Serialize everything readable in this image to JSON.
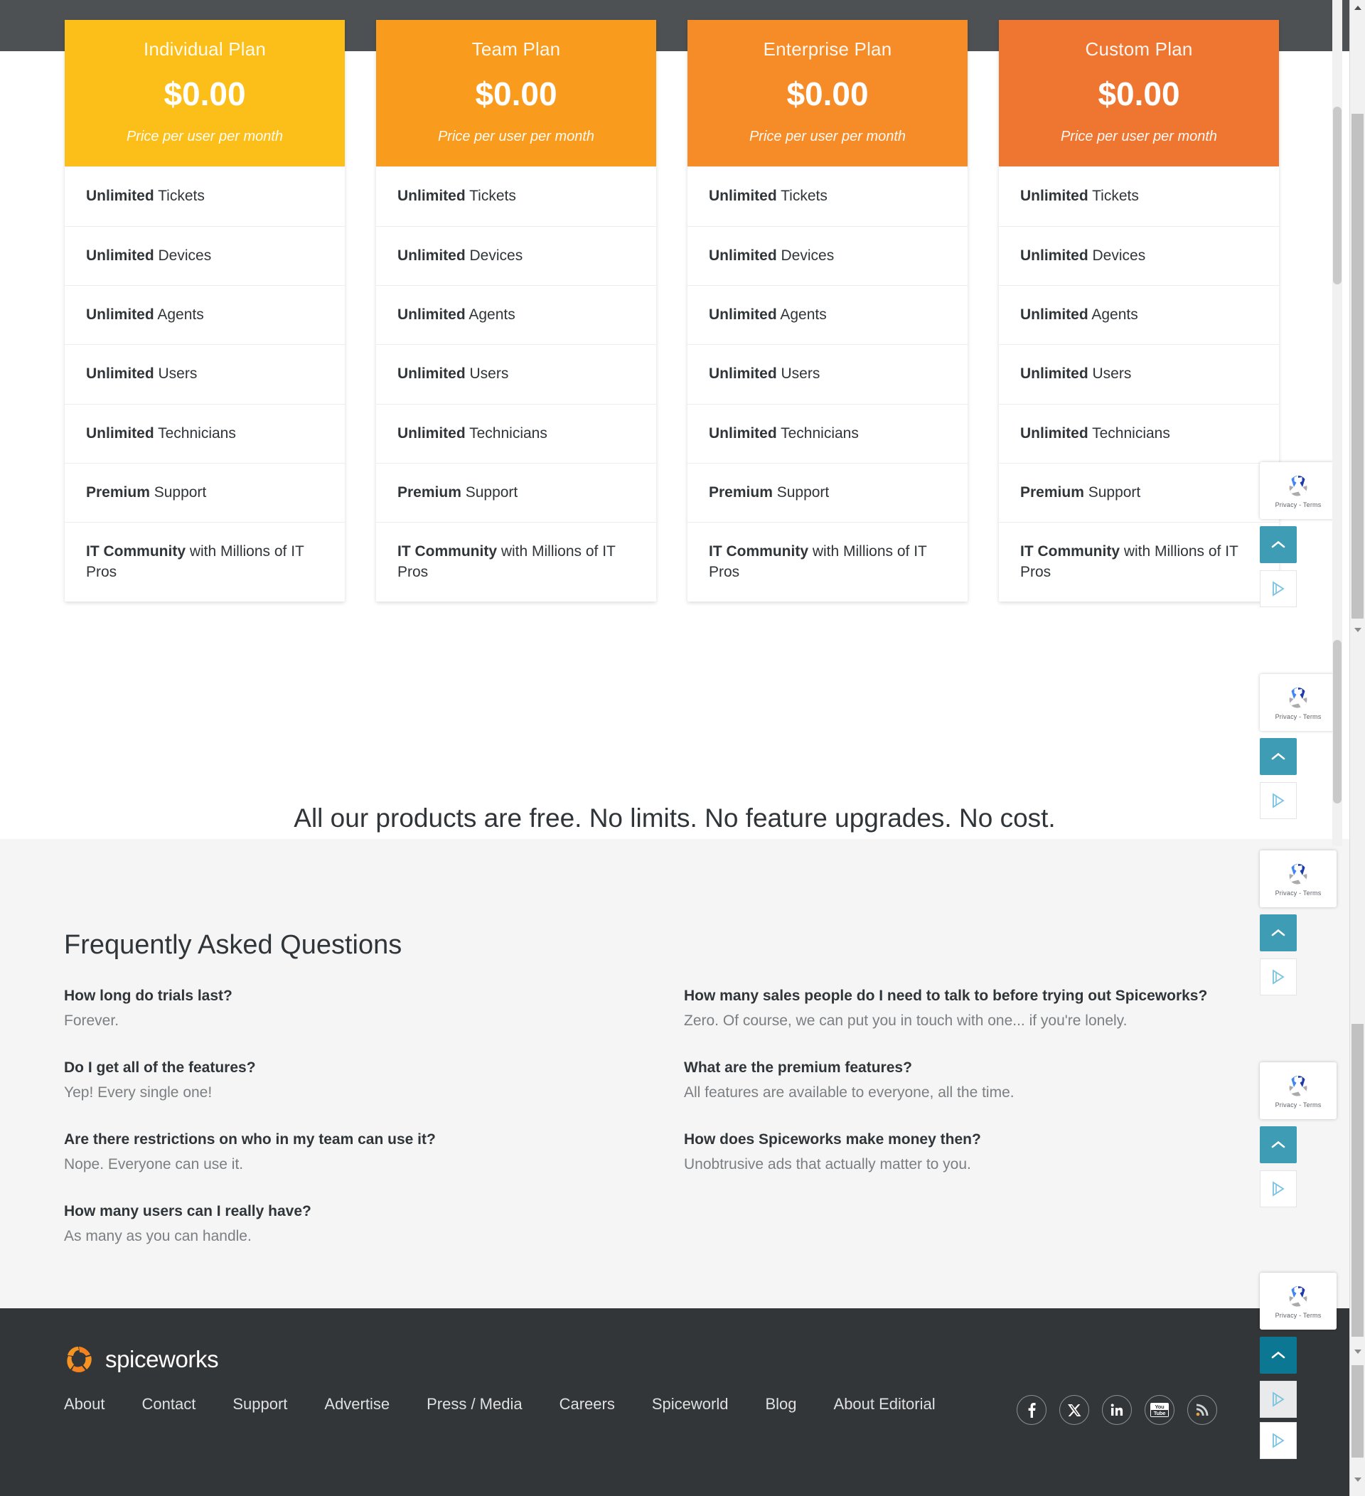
{
  "plans": [
    {
      "name": "Individual Plan",
      "price": "$0.00",
      "note": "Price per user per month",
      "color": "#fcbe18",
      "features": [
        {
          "bold": "Unlimited",
          "rest": " Tickets"
        },
        {
          "bold": "Unlimited",
          "rest": " Devices"
        },
        {
          "bold": "Unlimited",
          "rest": " Agents"
        },
        {
          "bold": "Unlimited",
          "rest": " Users"
        },
        {
          "bold": "Unlimited",
          "rest": " Technicians"
        },
        {
          "bold": "Premium",
          "rest": " Support"
        },
        {
          "bold": "IT Community",
          "rest": " with Millions of IT Pros"
        }
      ]
    },
    {
      "name": "Team Plan",
      "price": "$0.00",
      "note": "Price per user per month",
      "color": "#f99b1c",
      "features": [
        {
          "bold": "Unlimited",
          "rest": " Tickets"
        },
        {
          "bold": "Unlimited",
          "rest": " Devices"
        },
        {
          "bold": "Unlimited",
          "rest": " Agents"
        },
        {
          "bold": "Unlimited",
          "rest": " Users"
        },
        {
          "bold": "Unlimited",
          "rest": " Technicians"
        },
        {
          "bold": "Premium",
          "rest": " Support"
        },
        {
          "bold": "IT Community",
          "rest": " with Millions of IT Pros"
        }
      ]
    },
    {
      "name": "Enterprise Plan",
      "price": "$0.00",
      "note": "Price per user per month",
      "color": "#f68c27",
      "features": [
        {
          "bold": "Unlimited",
          "rest": " Tickets"
        },
        {
          "bold": "Unlimited",
          "rest": " Devices"
        },
        {
          "bold": "Unlimited",
          "rest": " Agents"
        },
        {
          "bold": "Unlimited",
          "rest": " Users"
        },
        {
          "bold": "Unlimited",
          "rest": " Technicians"
        },
        {
          "bold": "Premium",
          "rest": " Support"
        },
        {
          "bold": "IT Community",
          "rest": " with Millions of IT Pros"
        }
      ]
    },
    {
      "name": "Custom Plan",
      "price": "$0.00",
      "note": "Price per user per month",
      "color": "#ef7631",
      "features": [
        {
          "bold": "Unlimited",
          "rest": " Tickets"
        },
        {
          "bold": "Unlimited",
          "rest": " Devices"
        },
        {
          "bold": "Unlimited",
          "rest": " Agents"
        },
        {
          "bold": "Unlimited",
          "rest": " Users"
        },
        {
          "bold": "Unlimited",
          "rest": " Technicians"
        },
        {
          "bold": "Premium",
          "rest": " Support"
        },
        {
          "bold": "IT Community",
          "rest": " with Millions of IT Pros"
        }
      ]
    }
  ],
  "tagline": "All our products are free. No limits. No feature upgrades. No cost.",
  "faq": {
    "heading": "Frequently Asked Questions",
    "left": [
      {
        "q": "How long do trials last?",
        "a": "Forever."
      },
      {
        "q": "Do I get all of the features?",
        "a": "Yep! Every single one!"
      },
      {
        "q": "Are there restrictions on who in my team can use it?",
        "a": "Nope. Everyone can use it."
      },
      {
        "q": "How many users can I really have?",
        "a": "As many as you can handle."
      }
    ],
    "right": [
      {
        "q": "How many sales people do I need to talk to before trying out Spiceworks?",
        "a": "Zero. Of course, we can put you in touch with one... if you're lonely."
      },
      {
        "q": "What are the premium features?",
        "a": "All features are available to everyone, all the time."
      },
      {
        "q": "How does Spiceworks make money then?",
        "a": "Unobtrusive ads that actually matter to you."
      }
    ]
  },
  "footer": {
    "brand": "spiceworks",
    "links": [
      "About",
      "Contact",
      "Support",
      "Advertise",
      "Press / Media",
      "Careers",
      "Spiceworld",
      "Blog",
      "About Editorial"
    ],
    "socials": [
      "facebook-icon",
      "x-icon",
      "linkedin-icon",
      "youtube-icon",
      "rss-icon"
    ],
    "background": "#333638"
  },
  "widgets": {
    "recaptcha_label": "Privacy - Terms",
    "scroll_top_icon": "chevron-up-icon",
    "play_icon": "play-icon",
    "accent": "#3e9cb4"
  }
}
